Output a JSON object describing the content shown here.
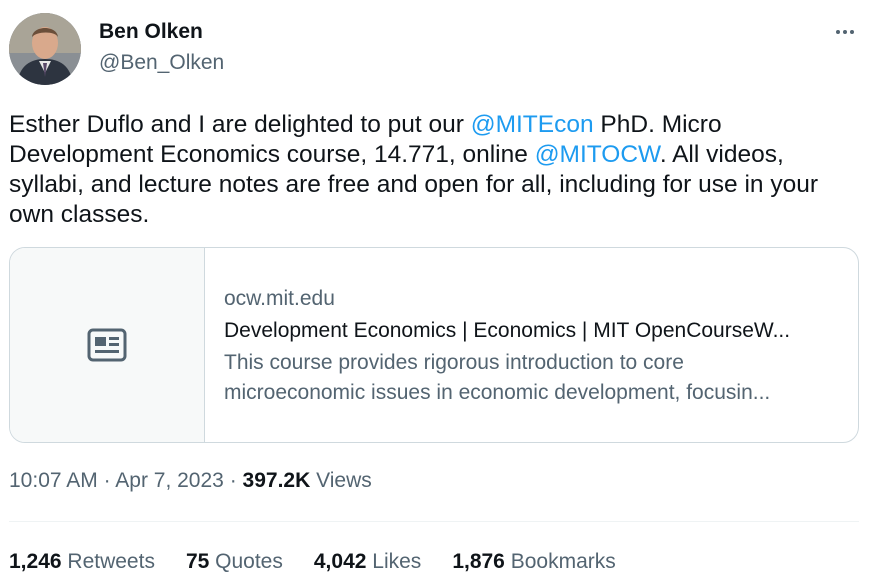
{
  "author": {
    "name": "Ben Olken",
    "handle": "@Ben_Olken"
  },
  "tweet": {
    "text_1": "Esther Duflo and I are delighted to put our ",
    "mention_1": "@MITEcon",
    "text_2": " PhD. Micro Development Economics course, 14.771, online ",
    "mention_2": "@MITOCW",
    "text_3": ". All videos, syllabi, and lecture notes are free and open for all, including for use in your own classes."
  },
  "card": {
    "icon": "article-icon",
    "domain": "ocw.mit.edu",
    "title": "Development Economics | Economics | MIT OpenCourseW...",
    "description_line_1": "This course provides rigorous introduction to core",
    "description_line_2": "microeconomic issues in economic development, focusin..."
  },
  "meta": {
    "time": "10:07 AM",
    "separator": "·",
    "date": "Apr 7, 2023",
    "views_count": "397.2K",
    "views_label": "Views"
  },
  "stats": {
    "retweets_count": "1,246",
    "retweets_label": "Retweets",
    "quotes_count": "75",
    "quotes_label": "Quotes",
    "likes_count": "4,042",
    "likes_label": "Likes",
    "bookmarks_count": "1,876",
    "bookmarks_label": "Bookmarks"
  },
  "colors": {
    "link": "#1d9bf0",
    "text": "#0f1419",
    "secondary": "#536471",
    "border": "#cfd9de"
  }
}
